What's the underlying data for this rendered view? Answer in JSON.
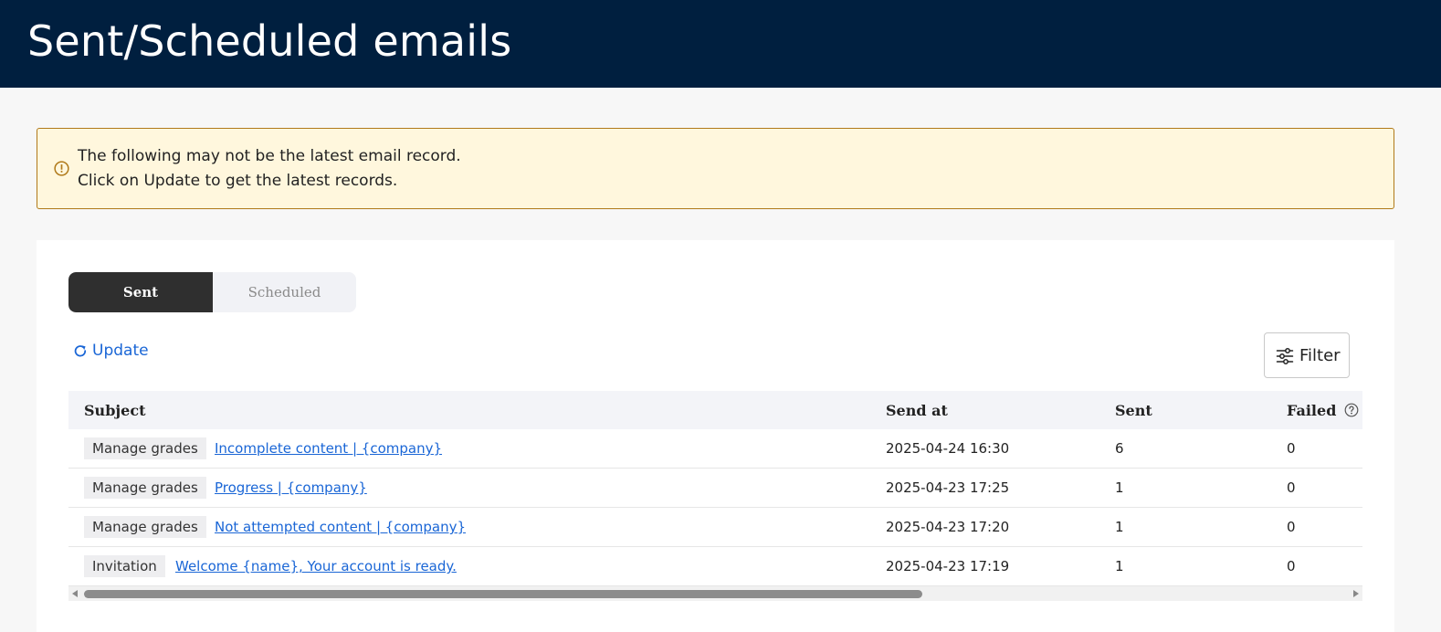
{
  "header": {
    "title": "Sent/Scheduled emails"
  },
  "alert": {
    "icon": "warning-circle-icon",
    "line1": "The following may not be the latest email record.",
    "line2": "Click on Update to get the latest records."
  },
  "tabs": [
    {
      "label": "Sent",
      "active": true
    },
    {
      "label": "Scheduled",
      "active": false
    }
  ],
  "toolbar": {
    "update_label": "Update",
    "filter_label": "Filter"
  },
  "table": {
    "columns": [
      "Subject",
      "Send at",
      "Sent",
      "Failed"
    ],
    "rows": [
      {
        "tag": "Manage grades",
        "subject": "Incomplete content | {company}",
        "send_at": "2025-04-24 16:30",
        "sent": "6",
        "failed": "0"
      },
      {
        "tag": "Manage grades",
        "subject": "Progress | {company}",
        "send_at": "2025-04-23 17:25",
        "sent": "1",
        "failed": "0"
      },
      {
        "tag": "Manage grades",
        "subject": "Not attempted content | {company}",
        "send_at": "2025-04-23 17:20",
        "sent": "1",
        "failed": "0"
      },
      {
        "tag": "Invitation",
        "subject": "Welcome {name}, Your account is ready.",
        "send_at": "2025-04-23 17:19",
        "sent": "1",
        "failed": "0"
      }
    ]
  },
  "colors": {
    "header_bg": "#001f3f",
    "alert_bg": "#fff7dd",
    "alert_border": "#b07a1a",
    "link": "#1a66d6",
    "active_tab": "#2f2f2f"
  }
}
